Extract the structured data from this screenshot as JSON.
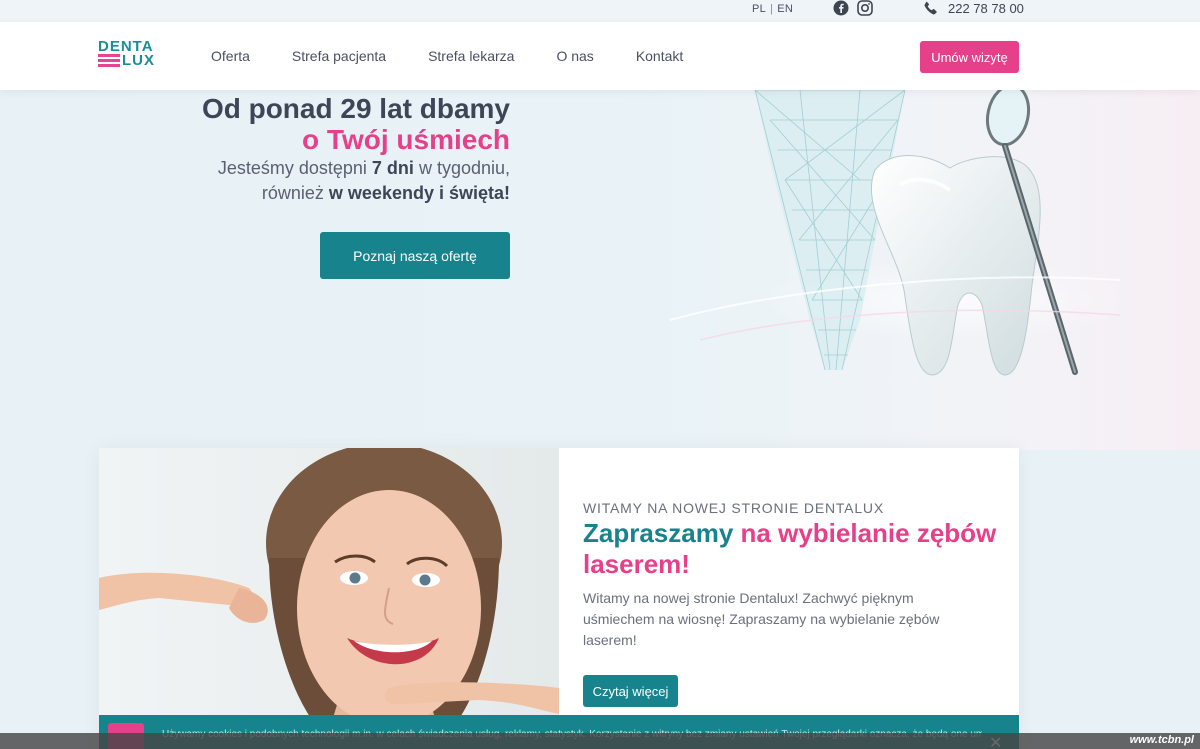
{
  "topbar": {
    "lang_pl": "PL",
    "lang_sep": "|",
    "lang_en": "EN",
    "phone": "222 78 78 00",
    "icons": [
      "facebook-icon",
      "instagram-icon",
      "phone-icon"
    ]
  },
  "header": {
    "logo_top": "DENTA",
    "logo_bottom": "LUX",
    "nav": [
      "Oferta",
      "Strefa pacjenta",
      "Strefa lekarza",
      "O nas",
      "Kontakt"
    ],
    "cta": "Umów wizytę"
  },
  "hero": {
    "title_line1": "Od ponad 29 lat dbamy",
    "title_line2": "o Twój uśmiech",
    "sub_line1_a": "Jesteśmy dostępni ",
    "sub_line1_b": "7 dni",
    "sub_line1_c": " w tygodniu,",
    "sub_line2_a": "również ",
    "sub_line2_b": "w weekendy i święta!",
    "button": "Poznaj naszą ofertę"
  },
  "card": {
    "kicker": "WITAMY NA NOWEJ STRONIE DENTALUX",
    "title_teal": "Zapraszamy",
    "title_pink": " na wybielanie zębów laserem!",
    "text": "Witamy na nowej stronie Dentalux! Zachwyć pięknym uśmiechem na wiosnę! Zapraszamy na wybielanie zębów laserem!",
    "button": "Czytaj więcej"
  },
  "cookie": {
    "text": "Używamy cookies i podobnych technologii m.in. w celach świadczenia usług, reklamy, statystyk. Korzystanie z witryny bez zmiany ustawień Twojej przeglądarki oznacza, że będą one umieszczane w Twoim urządzeniu końcowym.",
    "close": "✕"
  },
  "watermark": "www.tcbn.pl",
  "colors": {
    "teal": "#17838c",
    "pink": "#e6408a",
    "dark": "#3e4556"
  }
}
